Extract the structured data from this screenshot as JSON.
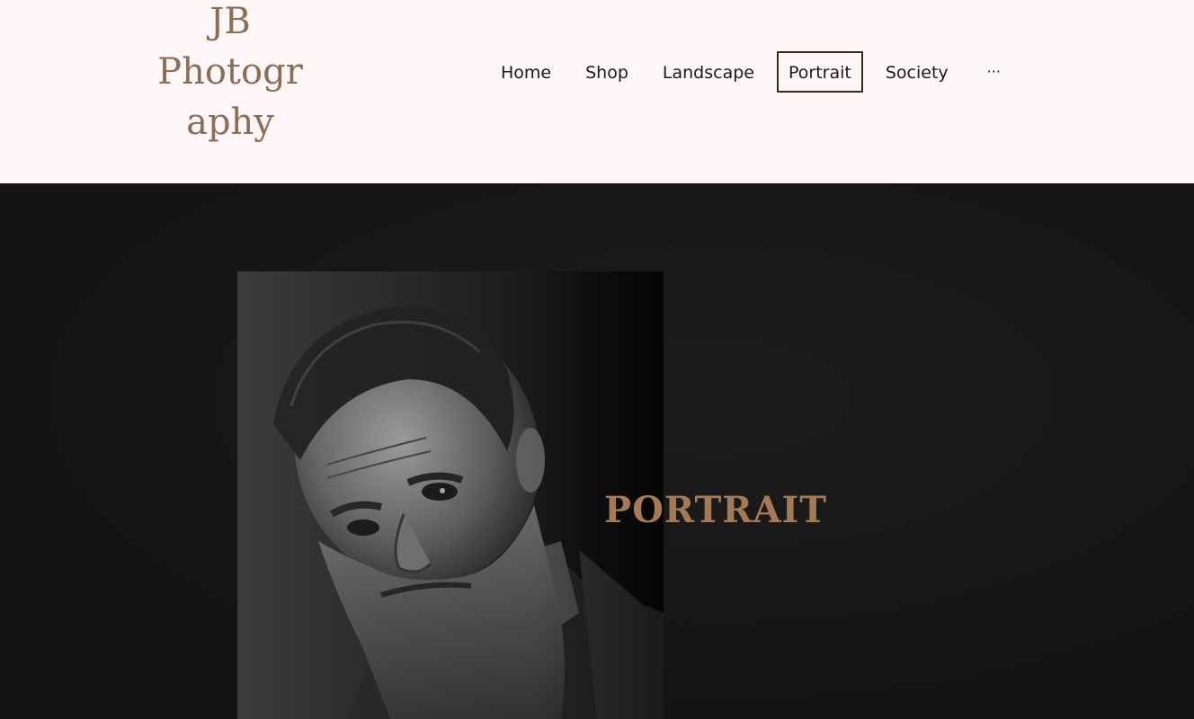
{
  "site": {
    "logo_line1": "JB",
    "logo_line2": "Photogr",
    "logo_line3": "aphy"
  },
  "nav": {
    "items": [
      {
        "label": "Home"
      },
      {
        "label": "Shop"
      },
      {
        "label": "Landscape"
      },
      {
        "label": "Portrait",
        "active": true
      },
      {
        "label": "Society"
      }
    ],
    "more_label": "···"
  },
  "hero": {
    "heading": "PORTRAIT",
    "image_alt_icon": "portrait-photo"
  },
  "colors": {
    "header_bg": "#fcf7f6",
    "logo": "#8a6e58",
    "heading_accent": "#a47a55",
    "page_bg": "#151515",
    "active_border": "#3a2a1c"
  }
}
